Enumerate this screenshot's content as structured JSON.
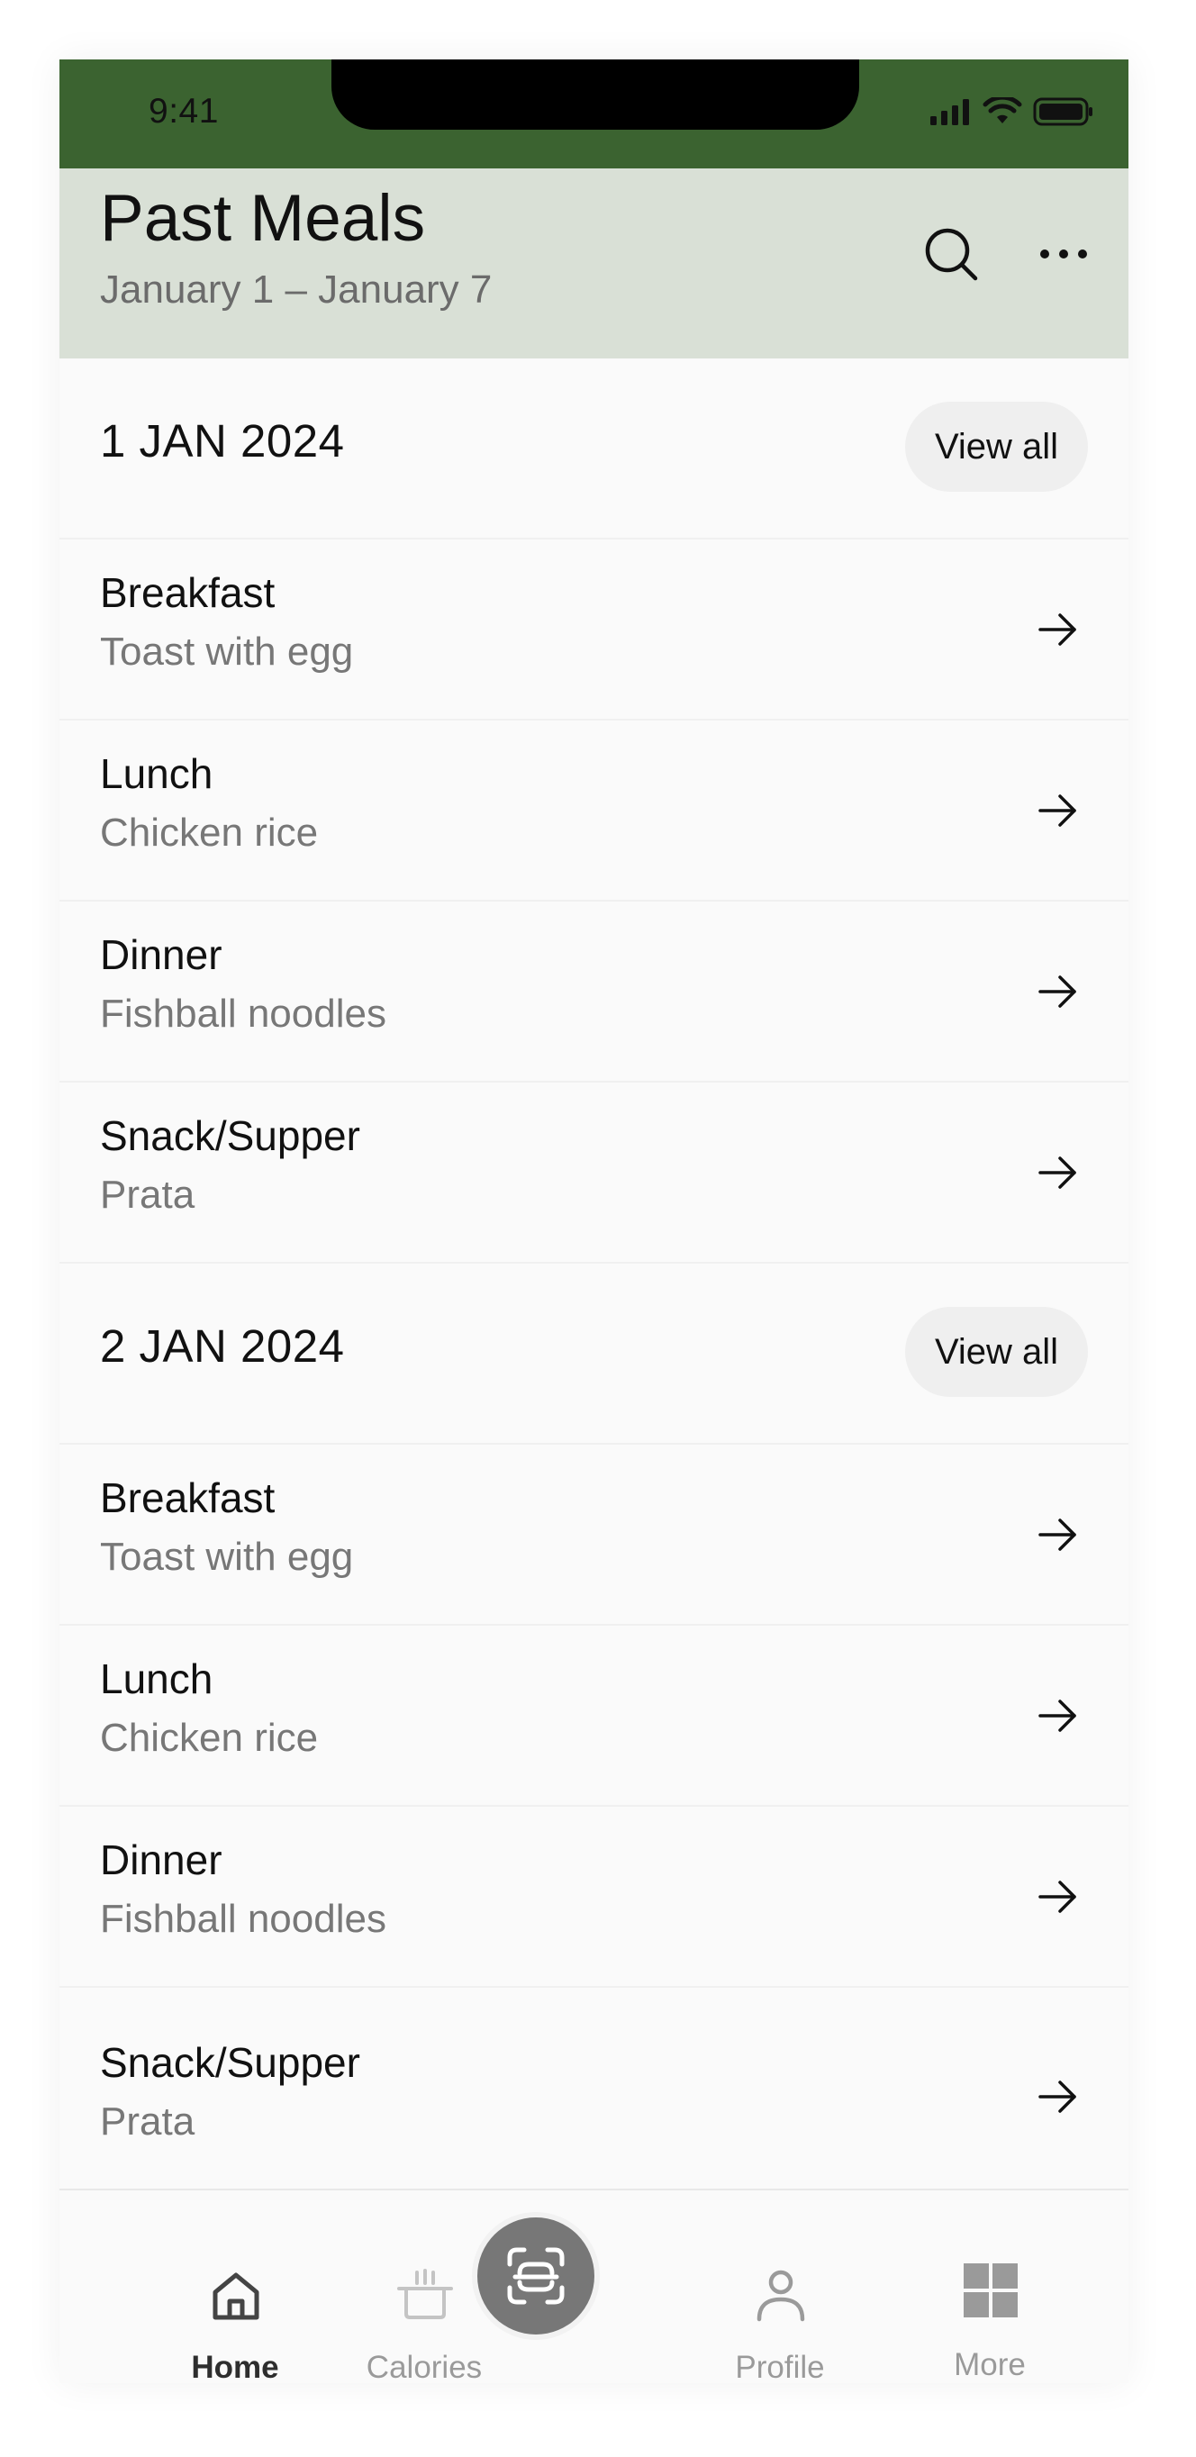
{
  "status_bar": {
    "time": "9:41"
  },
  "header": {
    "title": "Past Meals",
    "subtitle": "January 1 – January 7"
  },
  "days": [
    {
      "date": "1 JAN 2024",
      "view_all_label": "View all",
      "meals": [
        {
          "name": "Breakfast",
          "food": "Toast with egg"
        },
        {
          "name": "Lunch",
          "food": "Chicken rice"
        },
        {
          "name": "Dinner",
          "food": "Fishball noodles"
        },
        {
          "name": "Snack/Supper",
          "food": "Prata"
        }
      ]
    },
    {
      "date": "2 JAN 2024",
      "view_all_label": "View all",
      "meals": [
        {
          "name": "Breakfast",
          "food": "Toast with egg"
        },
        {
          "name": "Lunch",
          "food": "Chicken rice"
        },
        {
          "name": "Dinner",
          "food": "Fishball noodles"
        },
        {
          "name": "Snack/Supper",
          "food": "Prata"
        }
      ]
    }
  ],
  "bottom_nav": {
    "items": [
      {
        "label": "Home",
        "icon": "home-icon",
        "active": true
      },
      {
        "label": "Calories",
        "icon": "pot-icon",
        "active": false
      },
      {
        "label": "Profile",
        "icon": "person-icon",
        "active": false
      },
      {
        "label": "More",
        "icon": "grid-icon",
        "active": false
      }
    ],
    "center_icon": "scan-icon"
  },
  "colors": {
    "status_bar_bg": "#3b6330",
    "header_bg": "#d9e0d6",
    "text_primary": "#111111",
    "text_secondary": "#777777"
  }
}
